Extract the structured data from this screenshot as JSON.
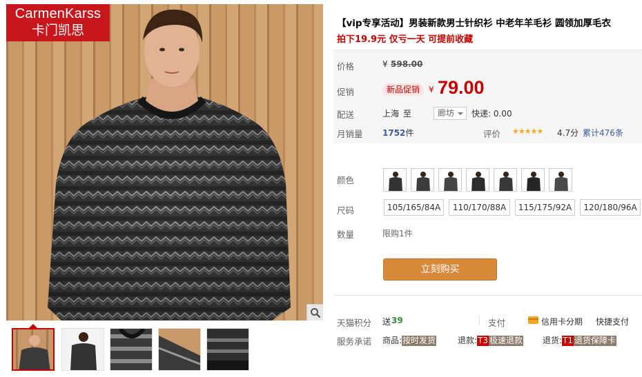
{
  "brand": {
    "name_en": "CarmenKarss",
    "name_cn": "卡门凯思"
  },
  "product": {
    "title": "【vip专享活动】男装新款男士针织衫 中老年羊毛衫 圆领加厚毛衣",
    "subtitle": "拍下19.9元 仅亏一天 可提前收藏"
  },
  "price": {
    "label": "价格",
    "currency": "¥",
    "original": "598.00"
  },
  "promo": {
    "label": "促销",
    "tag": "新品促销",
    "currency": "¥",
    "price": "79.00"
  },
  "shipping": {
    "label": "配送",
    "origin": "上海",
    "to": "至",
    "destination": "廊坊",
    "method": "快递: 0.00"
  },
  "sales": {
    "label": "月销量",
    "count": "1752",
    "unit": "件"
  },
  "rating": {
    "label": "评价",
    "stars": "★★★★★",
    "score": "4.7分",
    "reviews": "累计476条"
  },
  "color": {
    "label": "颜色",
    "swatch_count": 7
  },
  "size": {
    "label": "尺码",
    "options": [
      "105/165/84A",
      "110/170/88A",
      "115/175/92A",
      "120/180/96A"
    ]
  },
  "quantity": {
    "label": "数量",
    "limit": "限购1件"
  },
  "actions": {
    "buy_now": "立刻购买"
  },
  "points": {
    "label": "天猫积分",
    "give": "送",
    "value": "39"
  },
  "payment": {
    "label": "支付",
    "credit": "信用卡分期",
    "quick": "快捷支付"
  },
  "service": {
    "label": "服务承诺",
    "goods_label": "商品:",
    "goods_tag": "按时发货",
    "refund_label": "退款:",
    "refund_code": "T3",
    "refund_tag": "极速退款",
    "return_label": "退货:",
    "return_code": "T1",
    "return_tag": "退货保障卡"
  },
  "colors": {
    "accent_red": "#c40000",
    "buy_button": "#d9893a",
    "logo_bg": "#c8161d",
    "star": "#f5a623"
  },
  "icons": [
    "zoom-icon",
    "caret-down-icon",
    "credit-card-icon",
    "star-icon"
  ]
}
